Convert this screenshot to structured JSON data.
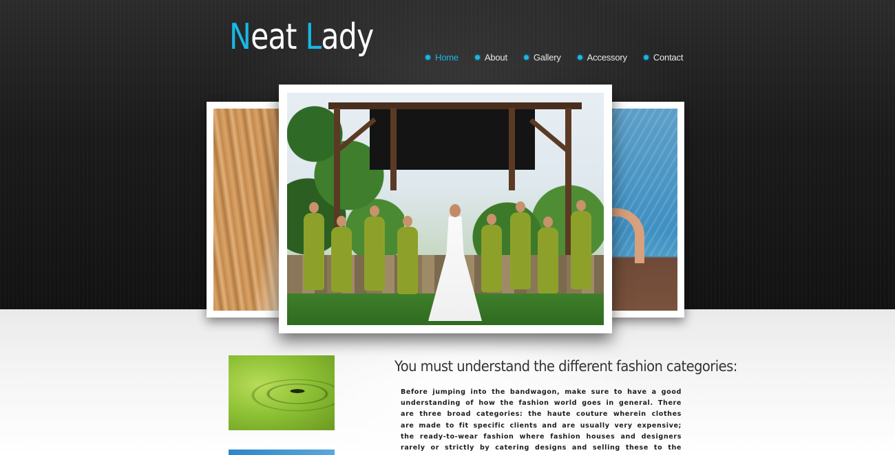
{
  "site": {
    "logo_first": "N",
    "logo_mid": "eat ",
    "logo_second": "L",
    "logo_end": "ady"
  },
  "nav": {
    "items": [
      {
        "label": "Home",
        "active": true
      },
      {
        "label": "About",
        "active": false
      },
      {
        "label": "Gallery",
        "active": false
      },
      {
        "label": "Accessory",
        "active": false
      },
      {
        "label": "Contact",
        "active": false
      }
    ]
  },
  "article": {
    "title": "You must understand the different fashion categories:",
    "body": "Before jumping into the bandwagon, make sure to have a good understanding of how the fashion world goes in general. There are three broad categories: the haute couture wherein clothes are made to fit specific clients and are usually very expensive; the ready-to-wear fashion where fashion houses and designers rarely or strictly by catering designs and selling these to the everyday customers who can afford designer labels; and the mass market which caters to everything else in the fashion world. Mass market"
  },
  "colors": {
    "accent": "#17b8e6",
    "header_bg": "#1a1a1a",
    "content_bg": "#f2f2f2",
    "dress": "#8da12a"
  }
}
